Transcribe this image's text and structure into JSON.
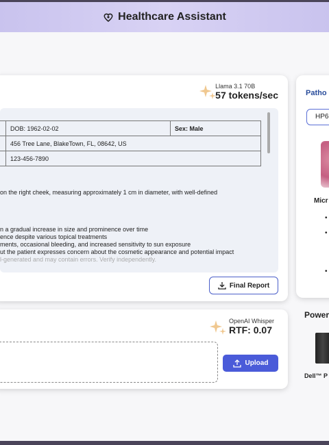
{
  "header": {
    "title": "Healthcare Assistant"
  },
  "report": {
    "model_name": "Llama 3.1 70B",
    "model_speed": "57 tokens/sec",
    "table": {
      "dob": "DOB: 1962-02-02",
      "sex": "Sex: Male",
      "address": "456 Tree Lane, BlakeTown, FL, 08642, US",
      "phone": "123-456-7890"
    },
    "lines": [
      "on the right cheek, measuring approximately 1 cm in diameter, with well-defined",
      "n a gradual increase in size and prominence over time",
      "ence despite various topical treatments",
      "ments, occasional bleeding, and increased sensitivity to sun exposure",
      "ut the patient expresses concern about the cosmetic appearance and potential impact",
      "l-generated and may contain errors. Verify independently."
    ],
    "final_button": "Final Report"
  },
  "audio": {
    "model_name": "OpenAI Whisper",
    "rtf": "RTF: 0.07",
    "upload_button": "Upload"
  },
  "pathology": {
    "title": "Patho",
    "select_value": "HP6",
    "micro_label": "Micr",
    "bullets": [
      "•",
      "•",
      "•"
    ]
  },
  "power": {
    "title": "Power",
    "product": "Dell™ P"
  }
}
